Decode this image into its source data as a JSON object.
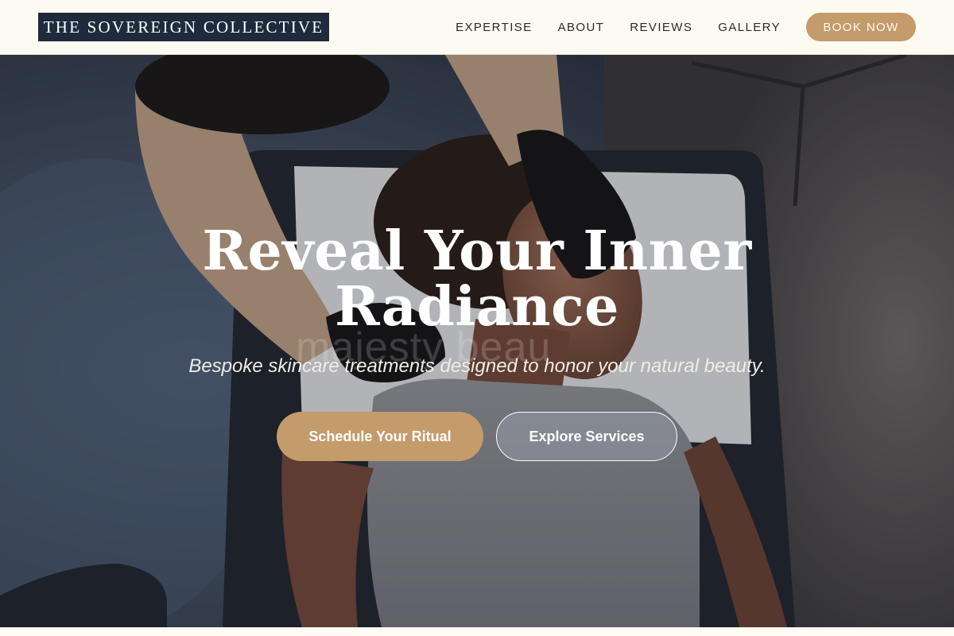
{
  "brand": {
    "name": "THE SOVEREIGN COLLECTIVE"
  },
  "nav": {
    "items": [
      {
        "label": "EXPERTISE"
      },
      {
        "label": "ABOUT"
      },
      {
        "label": "REVIEWS"
      },
      {
        "label": "GALLERY"
      }
    ],
    "cta_label": "BOOK NOW"
  },
  "hero": {
    "headline_line1": "Reveal Your Inner",
    "headline_line2": "Radiance",
    "watermark": "majesty beau",
    "subheadline": "Bespoke skincare treatments designed to honor your natural beauty.",
    "primary_cta": "Schedule Your Ritual",
    "secondary_cta": "Explore Services",
    "image_description_icon": "facial-treatment-photo"
  },
  "colors": {
    "brand_navy": "#1f2a3d",
    "accent_gold": "#c49b6b",
    "header_bg": "#fdfbf1",
    "text_dark": "#2a2a2a"
  }
}
